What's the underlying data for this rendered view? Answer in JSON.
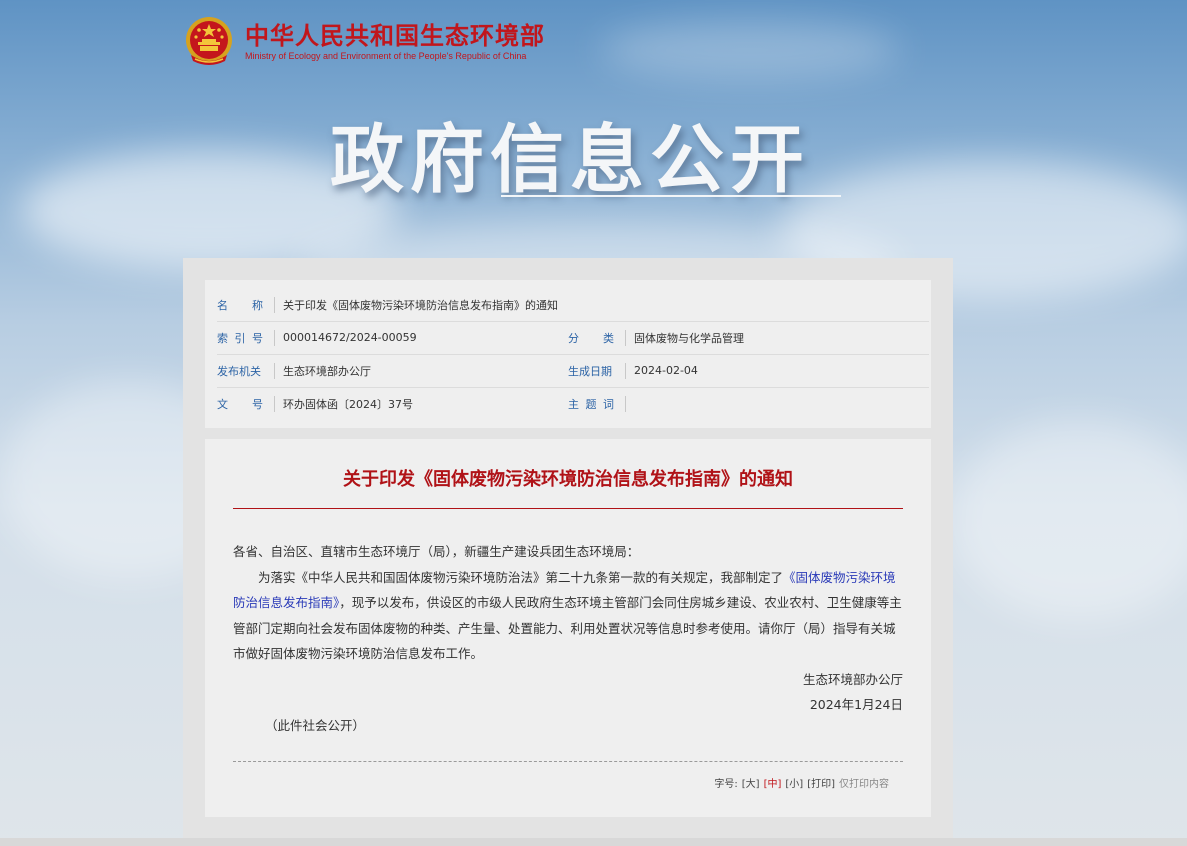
{
  "site": {
    "name_cn": "中华人民共和国生态环境部",
    "name_en": "Ministry of Ecology and Environment of the People's Republic of China",
    "banner_title": "政府信息公开",
    "emblem_icon": "national-emblem-icon"
  },
  "meta": {
    "name_label": [
      "名",
      "称"
    ],
    "name_value": "关于印发《固体废物污染环境防治信息发布指南》的通知",
    "index_label": [
      "索",
      "引",
      "号"
    ],
    "index_value": "000014672/2024-00059",
    "category_label": [
      "分",
      "类"
    ],
    "category_value": "固体废物与化学品管理",
    "issuer_label": "发布机关",
    "issuer_value": "生态环境部办公厅",
    "date_label": "生成日期",
    "date_value": "2024-02-04",
    "docno_label": [
      "文",
      "号"
    ],
    "docno_value": "环办固体函〔2024〕37号",
    "keywords_label": [
      "主",
      "题",
      "词"
    ],
    "keywords_value": ""
  },
  "document": {
    "title": "关于印发《固体废物污染环境防治信息发布指南》的通知",
    "salutation": "各省、自治区、直辖市生态环境厅（局），新疆生产建设兵团生态环境局：",
    "para_part1": "为落实《中华人民共和国固体废物污染环境防治法》第二十九条第一款的有关规定，我部制定了",
    "para_link": "《固体废物污染环境防治信息发布指南》",
    "para_part2": "，现予以发布，供设区的市级人民政府生态环境主管部门会同住房城乡建设、农业农村、卫生健康等主管部门定期向社会发布固体废物的种类、产生量、处置能力、利用处置状况等信息时参考使用。请你厅（局）指导有关城市做好固体废物污染环境防治信息发布工作。",
    "signature": "生态环境部办公厅",
    "date": "2024年1月24日",
    "note": "（此件社会公开）"
  },
  "tools": {
    "font_label": "字号:",
    "large": "[大]",
    "medium": "[中]",
    "small": "[小]",
    "print": "[打印]",
    "print_content": "仅打印内容"
  },
  "colors": {
    "brand_red": "#c1161c",
    "label_blue": "#2d64a6",
    "title_red": "#b01217",
    "link_blue": "#2b3bb8"
  }
}
